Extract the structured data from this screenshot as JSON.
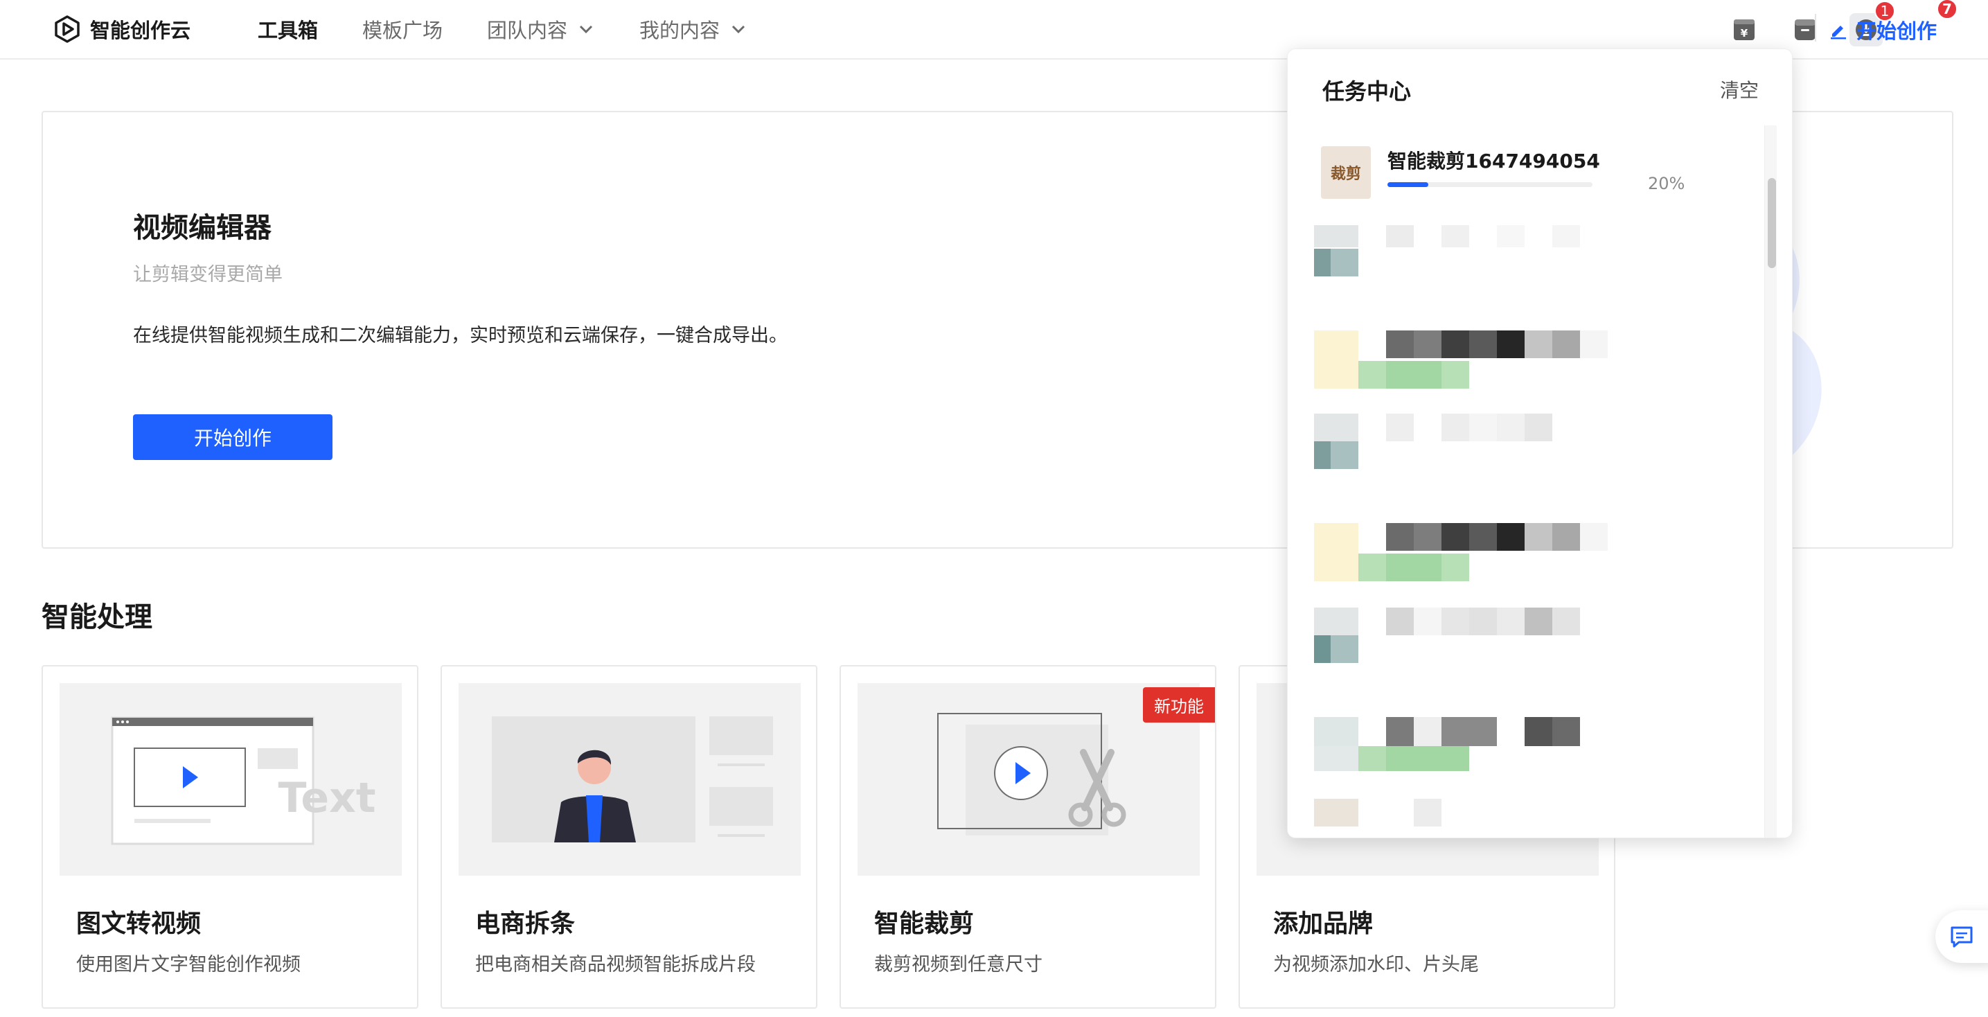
{
  "header": {
    "logo_text": "智能创作云",
    "nav": [
      {
        "label": "工具箱",
        "active": true,
        "dropdown": false
      },
      {
        "label": "模板广场",
        "active": false,
        "dropdown": false
      },
      {
        "label": "团队内容",
        "active": false,
        "dropdown": true
      },
      {
        "label": "我的内容",
        "active": false,
        "dropdown": true
      }
    ],
    "download_badge": "1",
    "start_label": "开始创作",
    "start_badge": "7"
  },
  "hero": {
    "title": "视频编辑器",
    "subtitle": "让剪辑变得更简单",
    "description": "在线提供智能视频生成和二次编辑能力，实时预览和云端保存，一键合成导出。",
    "button_label": "开始创作"
  },
  "section": {
    "title": "智能处理",
    "cards": [
      {
        "title": "图文转视频",
        "desc": "使用图片文字智能创作视频",
        "illustration_text": "Text",
        "tag": ""
      },
      {
        "title": "电商拆条",
        "desc": "把电商相关商品视频智能拆成片段",
        "tag": ""
      },
      {
        "title": "智能裁剪",
        "desc": "裁剪视频到任意尺寸",
        "tag": "新功能"
      },
      {
        "title": "添加品牌",
        "desc": "为视频添加水印、片头尾",
        "tag": ""
      }
    ]
  },
  "task_center": {
    "title": "任务中心",
    "clear_label": "清空",
    "tasks": [
      {
        "thumb_label": "裁剪",
        "name": "智能裁剪1647494054",
        "progress_percent": 20,
        "progress_text": "20%"
      }
    ]
  },
  "colors": {
    "accent": "#1f61ff",
    "badge": "#e5343a",
    "new_tag": "#e0322b"
  }
}
